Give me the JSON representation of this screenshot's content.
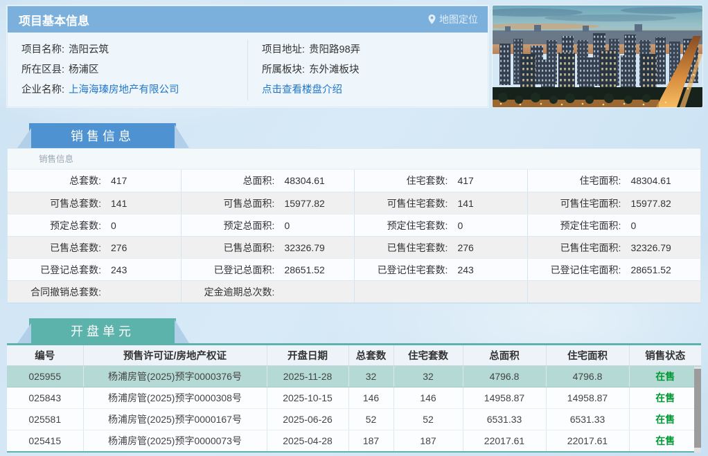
{
  "colors": {
    "header_blue": "#7bb0dc",
    "tab_blue": "#4e92d2",
    "tab_teal": "#5cb3ac",
    "highlight_row": "#b5dad6",
    "status_green": "#009933",
    "link_blue": "#2277cc"
  },
  "basic_info": {
    "title": "项目基本信息",
    "map_link_label": "地图定位",
    "map_pin_icon": "map-pin",
    "left": [
      {
        "label": "项目名称:",
        "value": "浩阳云筑"
      },
      {
        "label": "所在区县:",
        "value": "杨浦区"
      },
      {
        "label": "企业名称:",
        "value": "上海海瑧房地产有限公司"
      }
    ],
    "right": [
      {
        "label": "项目地址:",
        "value": "贵阳路98弄"
      },
      {
        "label": "所属板块:",
        "value": "东外滩板块"
      },
      {
        "label": "",
        "value": "点击查看楼盘介绍"
      }
    ]
  },
  "sales": {
    "tab": "销售信息",
    "subheader": "销售信息",
    "rows": [
      {
        "cells": [
          {
            "label": "总套数:",
            "value": "417"
          },
          {
            "label": "总面积:",
            "value": "48304.61"
          },
          {
            "label": "住宅套数:",
            "value": "417"
          },
          {
            "label": "住宅面积:",
            "value": "48304.61"
          }
        ]
      },
      {
        "cells": [
          {
            "label": "可售总套数:",
            "value": "141"
          },
          {
            "label": "可售总面积:",
            "value": "15977.82"
          },
          {
            "label": "可售住宅套数:",
            "value": "141"
          },
          {
            "label": "可售住宅面积:",
            "value": "15977.82"
          }
        ]
      },
      {
        "cells": [
          {
            "label": "预定总套数:",
            "value": "0"
          },
          {
            "label": "预定总面积:",
            "value": "0"
          },
          {
            "label": "预定住宅套数:",
            "value": "0"
          },
          {
            "label": "预定住宅面积:",
            "value": "0"
          }
        ]
      },
      {
        "cells": [
          {
            "label": "已售总套数:",
            "value": "276"
          },
          {
            "label": "已售总面积:",
            "value": "32326.79"
          },
          {
            "label": "已售住宅套数:",
            "value": "276"
          },
          {
            "label": "已售住宅面积:",
            "value": "32326.79"
          }
        ]
      },
      {
        "cells": [
          {
            "label": "已登记总套数:",
            "value": "243"
          },
          {
            "label": "已登记总面积:",
            "value": "28651.52"
          },
          {
            "label": "已登记住宅套数:",
            "value": "243"
          },
          {
            "label": "已登记住宅面积:",
            "value": "28651.52"
          }
        ]
      },
      {
        "cells": [
          {
            "label": "合同撤销总套数:",
            "value": ""
          },
          {
            "label": "定金逾期总次数:",
            "value": ""
          },
          {
            "label": "",
            "value": ""
          },
          {
            "label": "",
            "value": ""
          }
        ]
      }
    ]
  },
  "opening": {
    "tab": "开盘单元",
    "headers": [
      "编号",
      "预售许可证/房地产权证",
      "开盘日期",
      "总套数",
      "住宅套数",
      "总面积",
      "住宅面积",
      "销售状态"
    ],
    "rows": [
      {
        "id": "025955",
        "permit": "杨浦房管(2025)预字0000376号",
        "date": "2025-11-28",
        "total_units": "32",
        "res_units": "32",
        "total_area": "4796.8",
        "res_area": "4796.8",
        "status": "在售"
      },
      {
        "id": "025843",
        "permit": "杨浦房管(2025)预字0000308号",
        "date": "2025-10-15",
        "total_units": "146",
        "res_units": "146",
        "total_area": "14958.87",
        "res_area": "14958.87",
        "status": "在售"
      },
      {
        "id": "025581",
        "permit": "杨浦房管(2025)预字0000167号",
        "date": "2025-06-26",
        "total_units": "52",
        "res_units": "52",
        "total_area": "6531.33",
        "res_area": "6531.33",
        "status": "在售"
      },
      {
        "id": "025415",
        "permit": "杨浦房管(2025)预字0000073号",
        "date": "2025-04-28",
        "total_units": "187",
        "res_units": "187",
        "total_area": "22017.61",
        "res_area": "22017.61",
        "status": "在售"
      }
    ]
  }
}
